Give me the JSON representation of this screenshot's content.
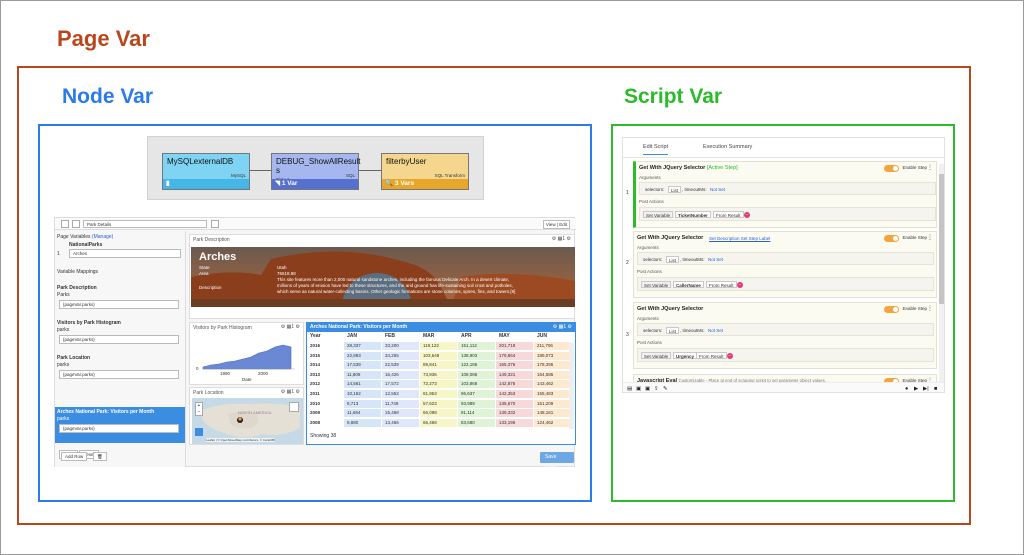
{
  "labels": {
    "page_var": "Page Var",
    "node_var": "Node Var",
    "script_var": "Script Var"
  },
  "colors": {
    "page_var": "#b7471d",
    "node_var": "#2b7be8",
    "script_var": "#2bbb2b",
    "toggle": "#f2a53c",
    "selection": "#3a8de0"
  },
  "flow": {
    "nodes": [
      {
        "name": "MySQLexternalDB",
        "type": "MySQL",
        "footer": ""
      },
      {
        "name": "DEBUG_ShowAllResult s",
        "type": "SQL",
        "sub": "Pick: 1",
        "footer": "1 Var"
      },
      {
        "name": "filterbyUser",
        "type": "SQL Transform",
        "footer": "3 Vars"
      }
    ]
  },
  "app": {
    "page_select": "Park Details",
    "view_edit": "View | Edit",
    "left": {
      "page_variables": "Page Variables",
      "manage": "(Manage)",
      "var_index": "1",
      "var_name": "NationalParks",
      "var_value": "Arches",
      "variable_mappings": "Variable Mappings",
      "mappings": [
        {
          "title": "Park Description",
          "sub": "Parks",
          "value": "{pageVar.parks}"
        },
        {
          "title": "Visitors by Park Histogram",
          "sub": "parks",
          "value": "{pageVar.parks}"
        },
        {
          "title": "Park Location",
          "sub": "parks",
          "value": "{pageVar.parks}"
        },
        {
          "title": "Arches National Park: Visitors per Month",
          "sub": "parks",
          "value": "{pageVar.parks}"
        }
      ],
      "apply": "Apply",
      "reset": "Reset",
      "add_row": "Add Row",
      "trash": "🗑"
    },
    "park_description": {
      "title": "Park Description",
      "heading": "Arches",
      "state_label": "State",
      "area_label": "Area",
      "description_label": "Description",
      "state_value": "Utah",
      "area_value": "76518.98",
      "desc_lines": [
        "This site features more than 2,000 natural sandstone arches, including the famous Delicate Arch. In a desert climate,",
        "millions of years of erosion have led to these structures, and the arid ground has life-sustaining soil crust and potholes,",
        "which serve as natural water-collecting basins. Other geologic formations are stone columns, spires, fins, and towers.[9]"
      ]
    },
    "histogram": {
      "title": "Visitors by Park Histogram",
      "y0": "0",
      "x1": "1990",
      "x2": "2000",
      "xlabel": "Date"
    },
    "park_location": {
      "title": "Park Location",
      "map_text": "NORTH AMERICA",
      "attribution": "Leaflet | © OpenStreetMap contributors, © CartoDB"
    },
    "visitors_table": {
      "title": "Arches National Park: Visitors per Month",
      "columns": [
        "Year",
        "JAN",
        "FEB",
        "MAR",
        "APR",
        "MAY",
        "JUN"
      ],
      "rows": [
        [
          "2016",
          "28,337",
          "33,200",
          "119,122",
          "151,112",
          "201,718",
          "211,706"
        ],
        [
          "2015",
          "22,893",
          "34,255",
          "103,649",
          "138,903",
          "179,864",
          "189,073"
        ],
        [
          "2014",
          "17,539",
          "22,539",
          "89,841",
          "122,186",
          "165,376",
          "178,396"
        ],
        [
          "2013",
          "11,809",
          "16,426",
          "73,936",
          "108,086",
          "149,321",
          "164,585"
        ],
        [
          "2012",
          "14,561",
          "17,572",
          "72,273",
          "103,868",
          "142,876",
          "143,462"
        ],
        [
          "2011",
          "10,162",
          "12,552",
          "61,953",
          "96,637",
          "142,353",
          "155,483"
        ],
        [
          "2010",
          "8,713",
          "11,749",
          "57,623",
          "93,989",
          "135,670",
          "151,209"
        ],
        [
          "2009",
          "11,684",
          "15,468",
          "66,098",
          "91,114",
          "139,332",
          "148,161"
        ],
        [
          "2008",
          "9,880",
          "13,456",
          "66,468",
          "83,680",
          "133,196",
          "124,462"
        ]
      ],
      "footer": "Showing 38"
    },
    "save_page": "Save Page"
  },
  "script": {
    "tabs": [
      "Edit Script",
      "Execution Summary"
    ],
    "steps": [
      {
        "num": "1",
        "title": "Get With JQuery Selector",
        "title_sub": "[Active Step]",
        "links": "",
        "enable_label": "Enable Step",
        "arguments_label": "Arguments",
        "args": [
          "selectors:",
          "List",
          ", timeoutMs:",
          "Not Set"
        ],
        "post_label": "Post Actions",
        "post": [
          "Set Variable",
          "TicketNumber",
          "From Result"
        ]
      },
      {
        "num": "2",
        "title": "Get With JQuery Selector",
        "title_sub": "",
        "links": "Set Description   Set Step Label",
        "enable_label": "Enable Step",
        "arguments_label": "Arguments",
        "args": [
          "selectors:",
          "List",
          ", timeoutMs:",
          "Not Set"
        ],
        "post_label": "Post Actions",
        "post": [
          "Set Variable",
          "CallerName",
          "From Result"
        ]
      },
      {
        "num": "3",
        "title": "Get With JQuery Selector",
        "title_sub": "",
        "links": "",
        "enable_label": "Enable Step",
        "arguments_label": "Arguments",
        "args": [
          "selectors:",
          "List",
          ", timeoutMs:",
          "Not Set"
        ],
        "post_label": "Post Actions",
        "post": [
          "Set Variable",
          "Urgency",
          "From Result"
        ]
      }
    ],
    "last_step": {
      "title": "Javascript Eval",
      "note": "Customizable - Place at end of scraping script to set parameter object values.",
      "enable_label": "Enable Step"
    }
  }
}
